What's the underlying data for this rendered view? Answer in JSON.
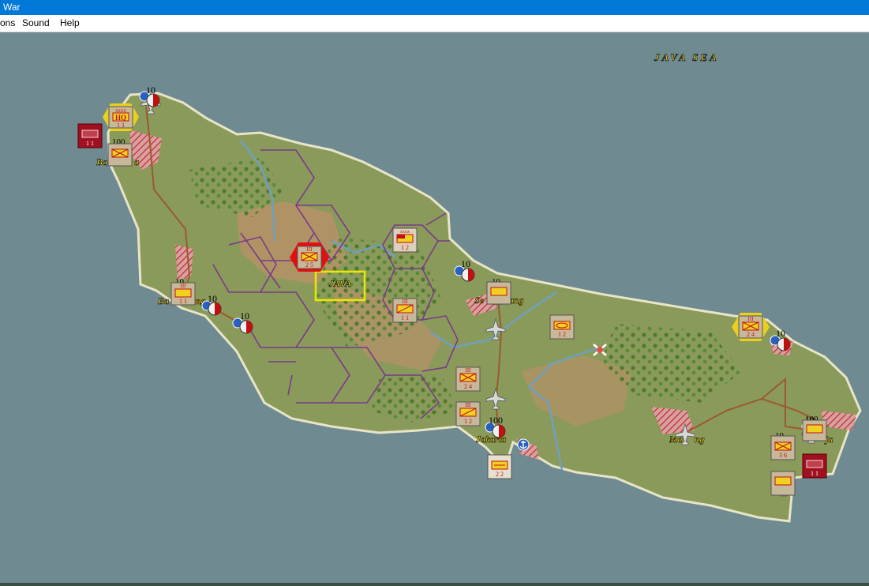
{
  "window": {
    "title": "War"
  },
  "menu": {
    "items": [
      {
        "label": "ons"
      },
      {
        "label": "Sound"
      },
      {
        "label": "Help"
      }
    ]
  },
  "map": {
    "sea_label": "JAVA SEA",
    "region_label": "JAVA",
    "cities": [
      "Ba",
      "a",
      "Ba",
      "ng",
      "Se",
      "ang",
      "Jakarta",
      "Ma",
      "ng",
      "ja"
    ],
    "airbase_strength": [
      "10",
      "10",
      "10",
      "10",
      "10",
      "100",
      "10"
    ],
    "stack_counts": [
      "100",
      "10",
      "10",
      "100",
      "10"
    ]
  },
  "units": {
    "hq": {
      "label": "HQ",
      "size": "xxxx",
      "strength": "1 1"
    },
    "selected_infantry": {
      "size": "III",
      "strength": "2 5"
    },
    "infantry_se": {
      "size": "III",
      "strength": "2 4"
    },
    "stack_sw": {
      "size": "III",
      "strength": "1 1"
    },
    "armor_center": {
      "size": "III",
      "strength": "1 1"
    },
    "corps_hq_center": {
      "size": "xxxx",
      "strength": "1 2"
    },
    "jakarta_infantry": {
      "size": "III",
      "strength": "2 4"
    },
    "jakarta_armor": {
      "size": "III",
      "strength": "1 2"
    },
    "mid_armor": {
      "strength": "1 2"
    },
    "south_unit": {
      "strength": "2 2"
    },
    "east_infantry": {
      "size": "III",
      "strength": "3 6"
    },
    "fleet_west": {
      "strength": "1 1"
    },
    "fleet_east": {
      "strength": "1 1"
    }
  },
  "colors": {
    "sea": "#6f8a90",
    "land": "#8a9a5a",
    "hex_border": "#7a3a8a",
    "selection": "#e8e800",
    "axis_red": "#b01020",
    "unit_tan": "#c8b89a"
  }
}
